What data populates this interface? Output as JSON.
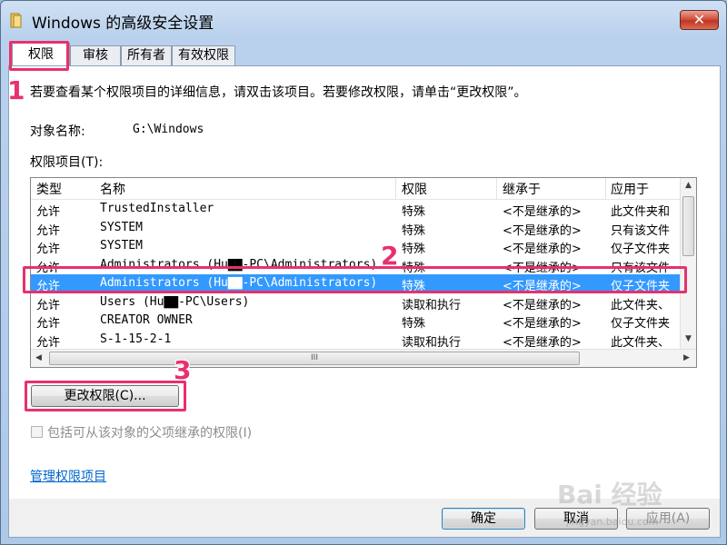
{
  "window": {
    "title": "Windows 的高级安全设置",
    "close_glyph": "✕"
  },
  "tabs": [
    {
      "label": "权限",
      "active": true
    },
    {
      "label": "审核",
      "active": false
    },
    {
      "label": "所有者",
      "active": false
    },
    {
      "label": "有效权限",
      "active": false
    }
  ],
  "info_text": "若要查看某个权限项目的详细信息，请双击该项目。若要修改权限，请单击“更改权限”。",
  "object": {
    "label": "对象名称:",
    "value": "G:\\Windows"
  },
  "entries_label": "权限项目(T):",
  "table": {
    "columns": [
      "类型",
      "名称",
      "权限",
      "继承于",
      "应用于"
    ],
    "rows": [
      [
        "允许",
        "TrustedInstaller",
        "特殊",
        "<不是继承的>",
        "此文件夹和"
      ],
      [
        "允许",
        "SYSTEM",
        "特殊",
        "<不是继承的>",
        "只有该文件"
      ],
      [
        "允许",
        "SYSTEM",
        "特殊",
        "<不是继承的>",
        "仅子文件夹"
      ],
      [
        "允许",
        "Administrators (Hu▇▇-PC\\Administrators)",
        "特殊",
        "<不是继承的>",
        "只有该文件"
      ],
      [
        "允许",
        "Administrators (Hu▇▇-PC\\Administrators)",
        "特殊",
        "<不是继承的>",
        "仅子文件夹"
      ],
      [
        "允许",
        "Users (Hu▇▇-PC\\Users)",
        "读取和执行",
        "<不是继承的>",
        "此文件夹、"
      ],
      [
        "允许",
        "CREATOR OWNER",
        "特殊",
        "<不是继承的>",
        "仅子文件夹"
      ],
      [
        "允许",
        "S-1-15-2-1",
        "读取和执行",
        "<不是继承的>",
        "此文件夹、"
      ]
    ],
    "selected_row": 4,
    "hscroll_grip": "III"
  },
  "change_button": "更改权限(C)...",
  "inherit_checkbox": {
    "label": "包括可从该对象的父项继承的权限(I)",
    "checked": false,
    "enabled": false
  },
  "manage_link": "管理权限项目",
  "buttons": {
    "ok": "确定",
    "cancel": "取消",
    "apply": "应用(A)"
  },
  "callouts": [
    "1",
    "2",
    "3"
  ],
  "watermark": {
    "text": "Bai 经验",
    "sub": "jingyan.baidu.com"
  },
  "colors": {
    "accent": "#e8316c",
    "selection": "#3399ff",
    "link": "#0066cc"
  }
}
